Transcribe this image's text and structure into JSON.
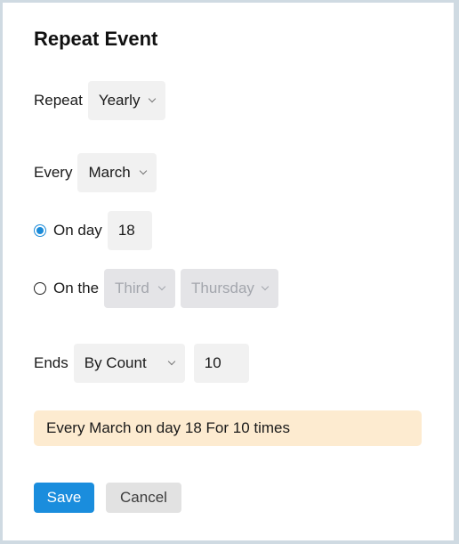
{
  "dialog": {
    "title": "Repeat Event"
  },
  "repeat": {
    "label": "Repeat",
    "value": "Yearly"
  },
  "every": {
    "label": "Every",
    "value": "March"
  },
  "on_day": {
    "label": "On day",
    "checked": true,
    "value": "18"
  },
  "on_the": {
    "label": "On the",
    "checked": false,
    "ordinal": "Third",
    "weekday": "Thursday"
  },
  "ends": {
    "label": "Ends",
    "type": "By Count",
    "count": "10"
  },
  "summary": {
    "text": "Every March on day 18 For 10 times"
  },
  "actions": {
    "save_label": "Save",
    "cancel_label": "Cancel"
  },
  "colors": {
    "accent": "#1a8ddd",
    "summary_bg": "#fdebd0",
    "border": "#cfdae2"
  }
}
